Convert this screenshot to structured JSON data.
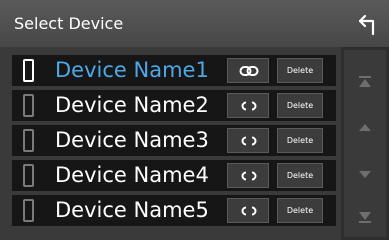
{
  "header": {
    "title": "Select Device",
    "back_icon": "back-arrow-icon"
  },
  "devices": [
    {
      "name": "Device Name1",
      "connected": true,
      "delete_label": "Delete"
    },
    {
      "name": "Device Name2",
      "connected": false,
      "delete_label": "Delete"
    },
    {
      "name": "Device Name3",
      "connected": false,
      "delete_label": "Delete"
    },
    {
      "name": "Device Name4",
      "connected": false,
      "delete_label": "Delete"
    },
    {
      "name": "Device Name5",
      "connected": false,
      "delete_label": "Delete"
    }
  ],
  "scroll": {
    "icons": [
      "scroll-top-icon",
      "scroll-up-icon",
      "scroll-down-icon",
      "scroll-bottom-icon"
    ]
  },
  "colors": {
    "active_name": "#4ea8e8",
    "inactive_phone": "#7a7a7a"
  }
}
